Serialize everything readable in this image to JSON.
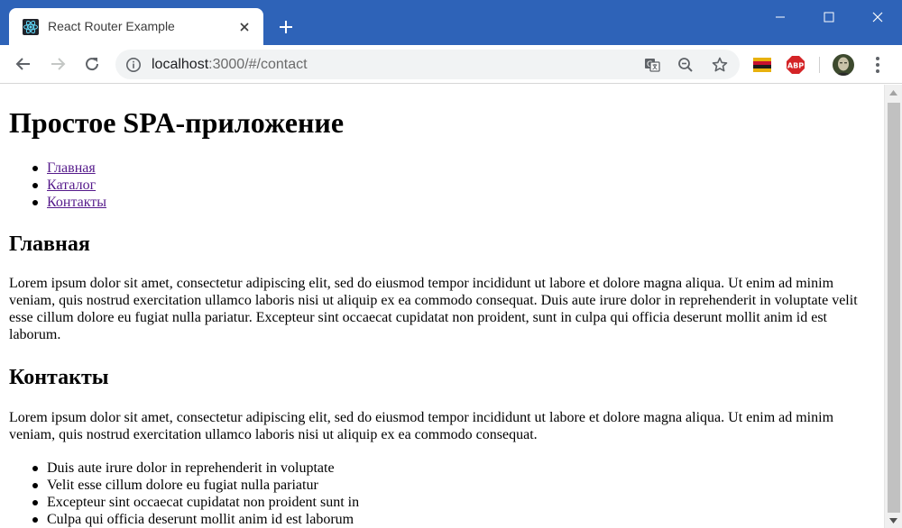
{
  "browser": {
    "tab": {
      "title": "React Router Example",
      "favicon": "react-logo-icon"
    },
    "address": {
      "host": "localhost",
      "path": ":3000/#/contact"
    },
    "colors": {
      "titlebar": "#2e63b8",
      "toolbar": "#ffffff",
      "omnibox": "#f1f3f4",
      "link_visited": "#551a8b"
    }
  },
  "page": {
    "title": "Простое SPA-приложение",
    "nav": [
      {
        "label": "Главная"
      },
      {
        "label": "Каталог"
      },
      {
        "label": "Контакты"
      }
    ],
    "home": {
      "heading": "Главная",
      "text": "Lorem ipsum dolor sit amet, consectetur adipiscing elit, sed do eiusmod tempor incididunt ut labore et dolore magna aliqua. Ut enim ad minim veniam, quis nostrud exercitation ullamco laboris nisi ut aliquip ex ea commodo consequat. Duis aute irure dolor in reprehenderit in voluptate velit esse cillum dolore eu fugiat nulla pariatur. Excepteur sint occaecat cupidatat non proident, sunt in culpa qui officia deserunt mollit anim id est laborum."
    },
    "contacts": {
      "heading": "Контакты",
      "text": "Lorem ipsum dolor sit amet, consectetur adipiscing elit, sed do eiusmod tempor incididunt ut labore et dolore magna aliqua. Ut enim ad minim veniam, quis nostrud exercitation ullamco laboris nisi ut aliquip ex ea commodo consequat.",
      "items": [
        "Duis aute irure dolor in reprehenderit in voluptate",
        "Velit esse cillum dolore eu fugiat nulla pariatur",
        "Excepteur sint occaecat cupidatat non proident sunt in",
        "Culpa qui officia deserunt mollit anim id est laborum"
      ]
    }
  }
}
